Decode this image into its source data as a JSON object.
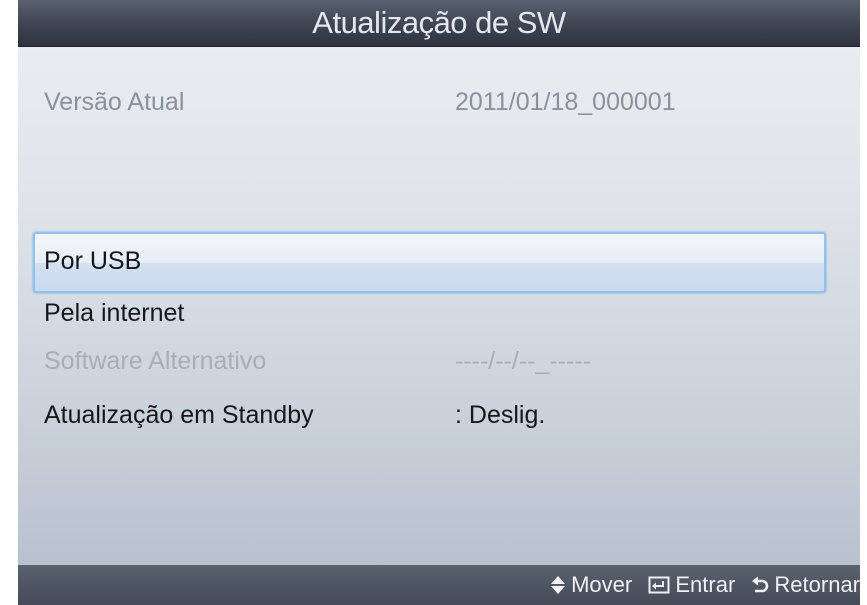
{
  "window": {
    "title": "Atualização de SW"
  },
  "info": {
    "current_version_label": "Versão Atual",
    "current_version_value": "2011/01/18_000001"
  },
  "menu": {
    "items": [
      {
        "label": "Por USB",
        "value": "",
        "state": "selected"
      },
      {
        "label": "Pela internet",
        "value": "",
        "state": "normal"
      },
      {
        "label": "Software Alternativo",
        "value": "----/--/--_-----",
        "state": "disabled"
      },
      {
        "label": "Atualização em Standby",
        "value": ": Deslig.",
        "state": "normal"
      }
    ]
  },
  "footer": {
    "hints": [
      {
        "icon": "up-down-arrows-icon",
        "label": "Mover"
      },
      {
        "icon": "enter-icon",
        "label": "Entrar"
      },
      {
        "icon": "return-icon",
        "label": "Retornar"
      }
    ]
  },
  "colors": {
    "title_bar": "#3d4350",
    "selection_border": "#8fc2ef",
    "disabled_text": "#a9aeb6"
  }
}
